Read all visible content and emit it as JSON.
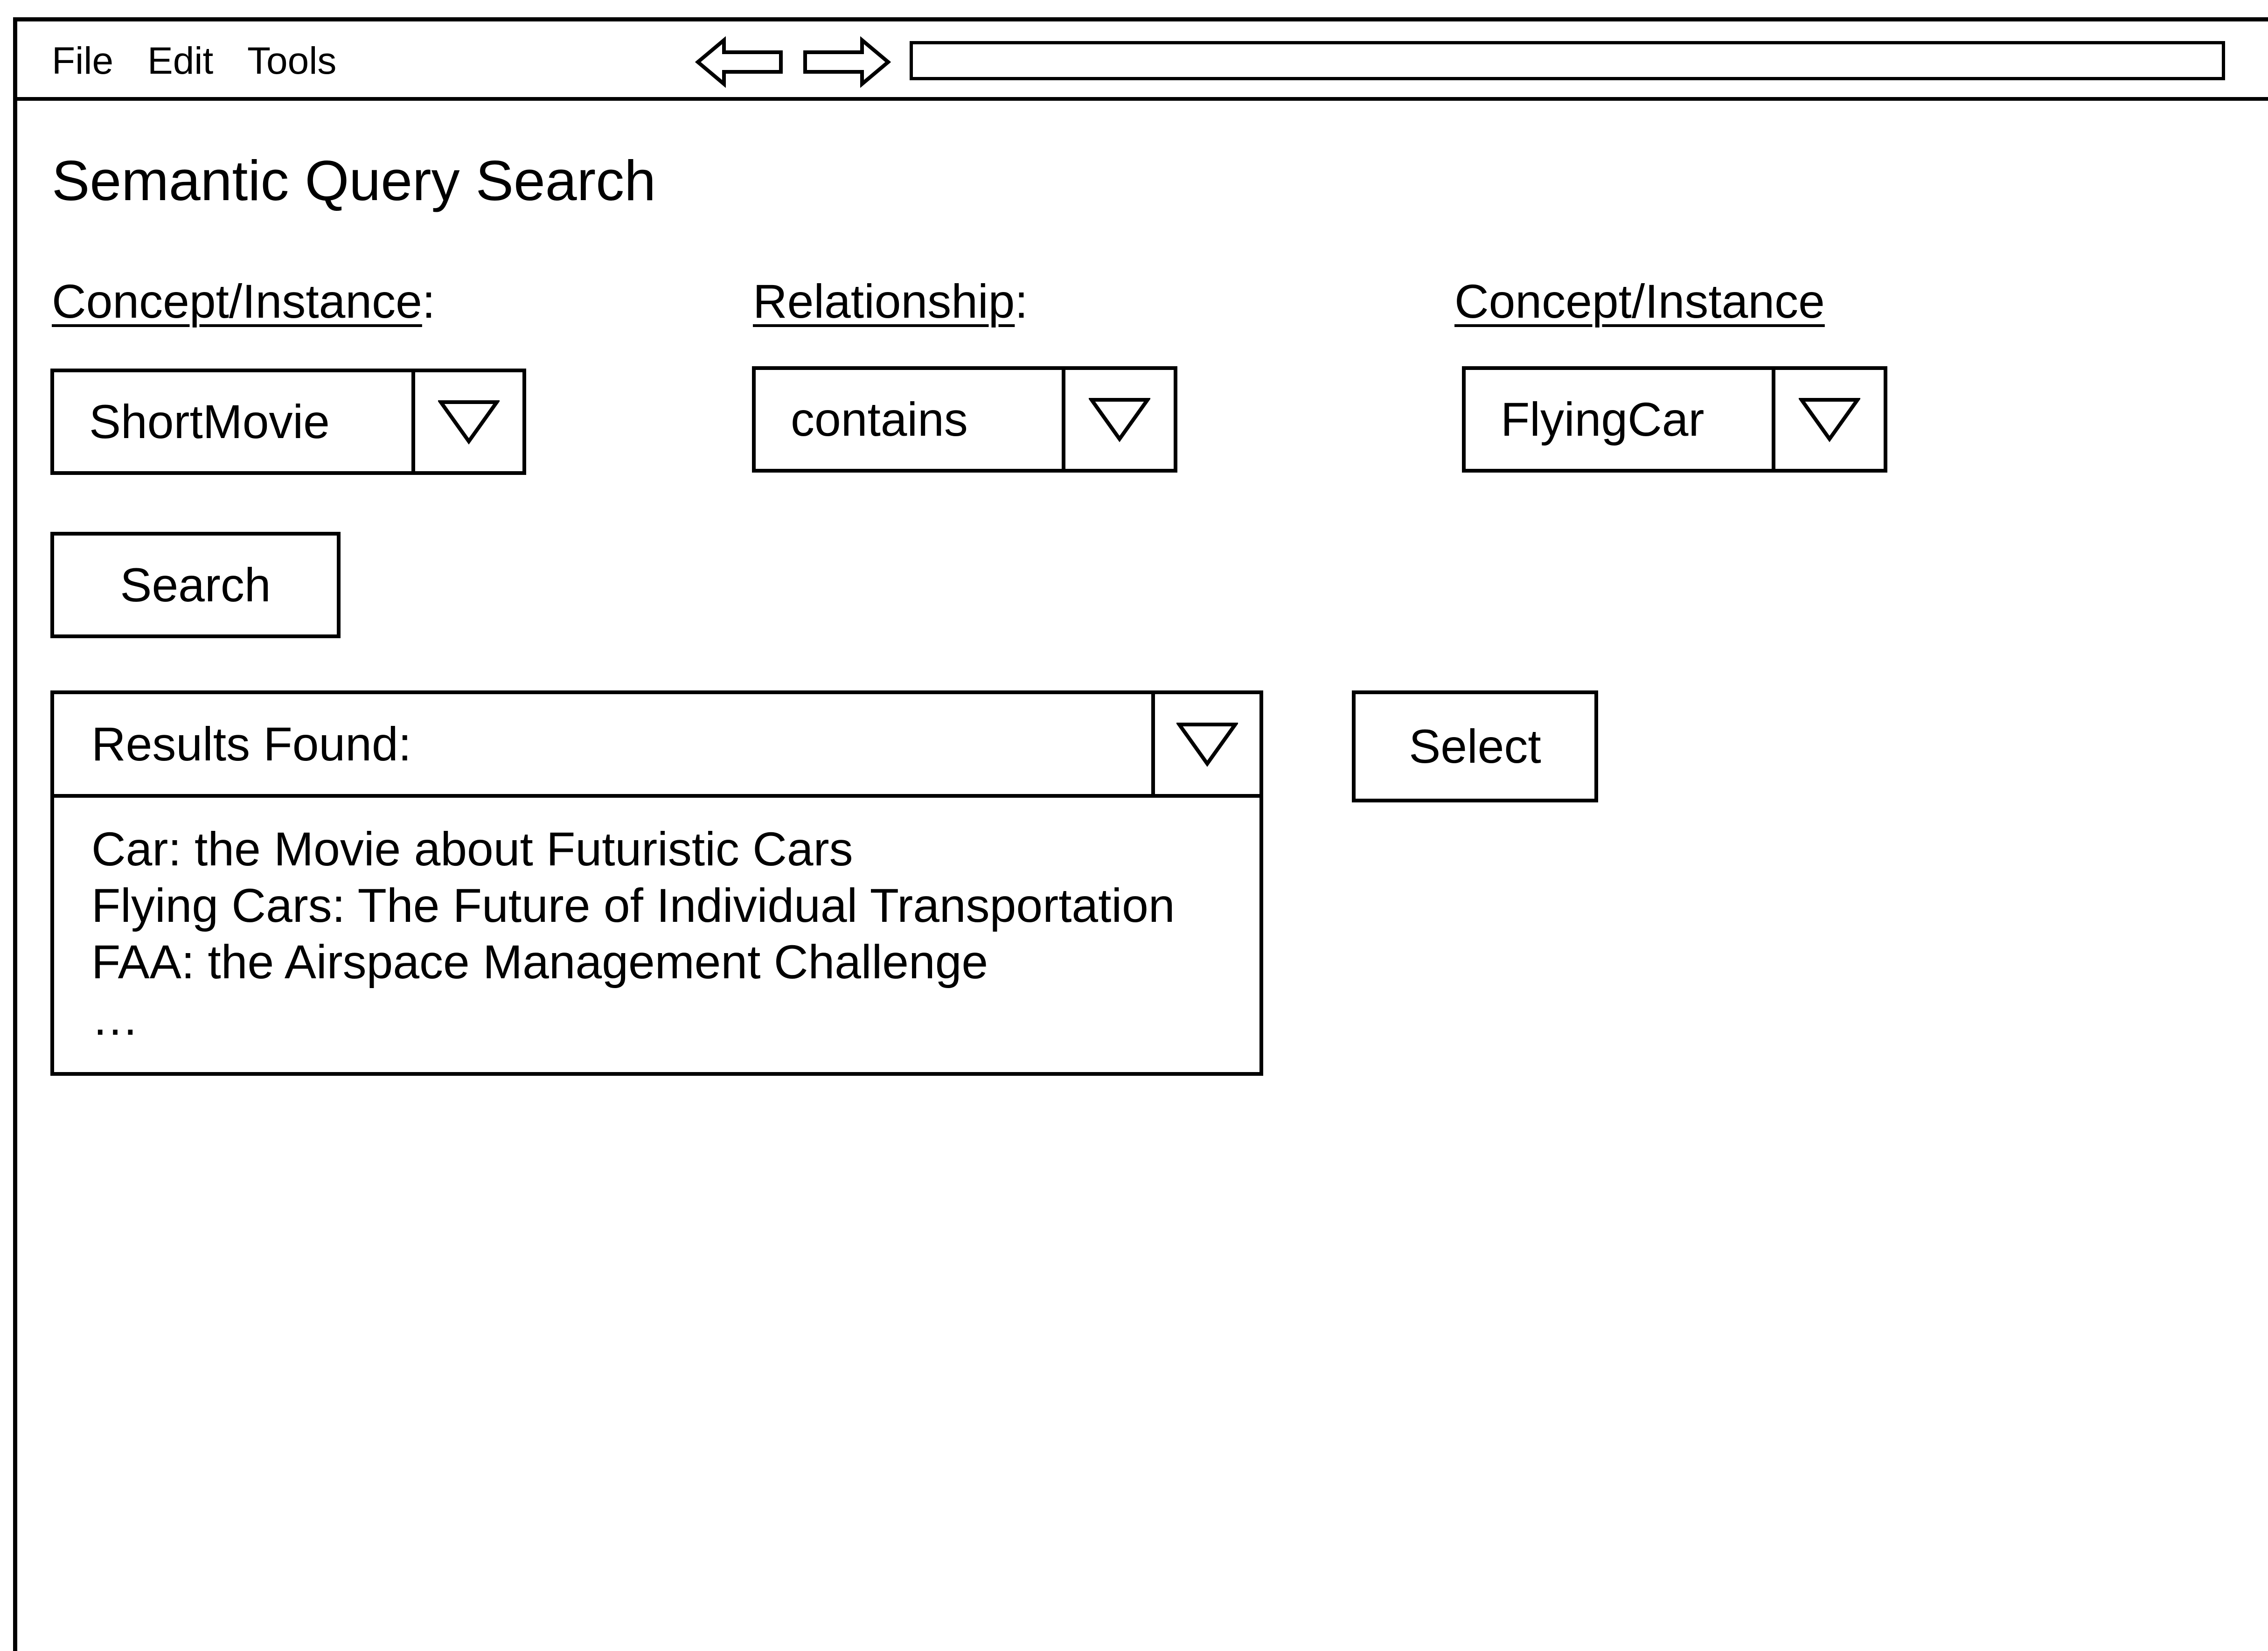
{
  "menu": {
    "file": "File",
    "edit": "Edit",
    "tools": "Tools"
  },
  "nav": {
    "back_icon": "left-arrow-outline",
    "forward_icon": "right-arrow-outline",
    "address_value": ""
  },
  "page": {
    "title": "Semantic Query Search"
  },
  "query": {
    "concept_1": {
      "label": "Concept/Instance",
      "label_suffix": ":",
      "value": "ShortMovie"
    },
    "relationship": {
      "label": "Relationship",
      "label_suffix": ":",
      "value": "contains"
    },
    "concept_2": {
      "label": "Concept/Instance",
      "value": "FlyingCar"
    },
    "search_label": "Search"
  },
  "results": {
    "header": "Results Found:",
    "items": [
      "Car: the Movie about Futuristic Cars",
      "Flying Cars: The Future of Individual Transportation",
      "FAA: the Airspace Management Challenge",
      "…"
    ],
    "select_label": "Select"
  }
}
